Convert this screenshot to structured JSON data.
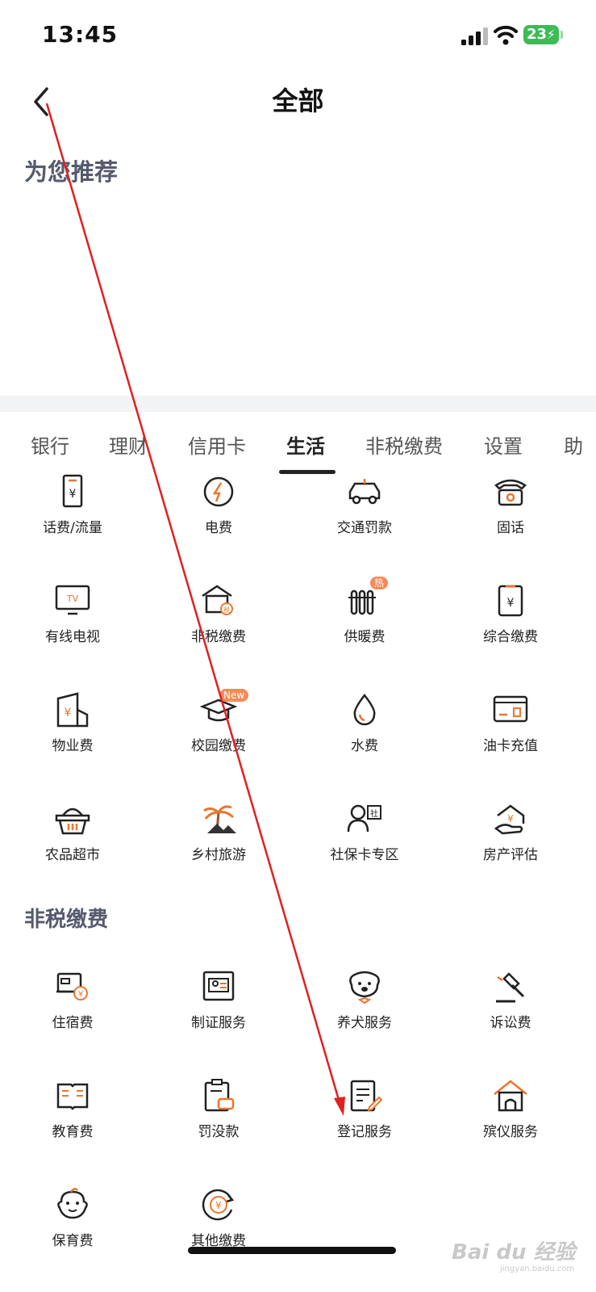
{
  "status_bar": {
    "time": "13:45",
    "battery": "23"
  },
  "nav": {
    "title": "全部"
  },
  "recommend": {
    "title": "为您推荐"
  },
  "tabs": [
    {
      "label": "银行"
    },
    {
      "label": "理财"
    },
    {
      "label": "信用卡"
    },
    {
      "label": "生活",
      "active": true
    },
    {
      "label": "非税缴费"
    },
    {
      "label": "设置"
    },
    {
      "label": "助"
    }
  ],
  "life_items": [
    {
      "label": "话费/流量",
      "icon": "phone-bill-icon"
    },
    {
      "label": "电费",
      "icon": "electricity-icon"
    },
    {
      "label": "交通罚款",
      "icon": "car-icon"
    },
    {
      "label": "固话",
      "icon": "landline-icon"
    },
    {
      "label": "有线电视",
      "icon": "tv-icon"
    },
    {
      "label": "非税缴费",
      "icon": "tax-house-icon"
    },
    {
      "label": "供暖费",
      "icon": "radiator-icon",
      "badge": "热"
    },
    {
      "label": "综合缴费",
      "icon": "bill-icon"
    },
    {
      "label": "物业费",
      "icon": "property-icon"
    },
    {
      "label": "校园缴费",
      "icon": "graduation-cap-icon",
      "badge": "New"
    },
    {
      "label": "水费",
      "icon": "water-drop-icon"
    },
    {
      "label": "油卡充值",
      "icon": "fuel-card-icon"
    },
    {
      "label": "农品超市",
      "icon": "basket-icon"
    },
    {
      "label": "乡村旅游",
      "icon": "palm-tree-icon"
    },
    {
      "label": "社保卡专区",
      "icon": "social-security-icon"
    },
    {
      "label": "房产评估",
      "icon": "house-hand-icon"
    }
  ],
  "nontax": {
    "title": "非税缴费",
    "items": [
      {
        "label": "住宿费",
        "icon": "bed-icon"
      },
      {
        "label": "制证服务",
        "icon": "id-card-icon"
      },
      {
        "label": "养犬服务",
        "icon": "dog-icon"
      },
      {
        "label": "诉讼费",
        "icon": "gavel-icon"
      },
      {
        "label": "教育费",
        "icon": "book-icon"
      },
      {
        "label": "罚没款",
        "icon": "clipboard-car-icon"
      },
      {
        "label": "登记服务",
        "icon": "document-pen-icon"
      },
      {
        "label": "殡仪服务",
        "icon": "funeral-house-icon"
      },
      {
        "label": "保育费",
        "icon": "baby-icon"
      },
      {
        "label": "其他缴费",
        "icon": "yen-circle-icon"
      }
    ]
  },
  "watermark": {
    "brand": "Bai du 经验",
    "url": "jingyan.baidu.com"
  },
  "colors": {
    "accent": "#e8772e",
    "annotation": "#e02020",
    "section_title": "#555a6e"
  }
}
